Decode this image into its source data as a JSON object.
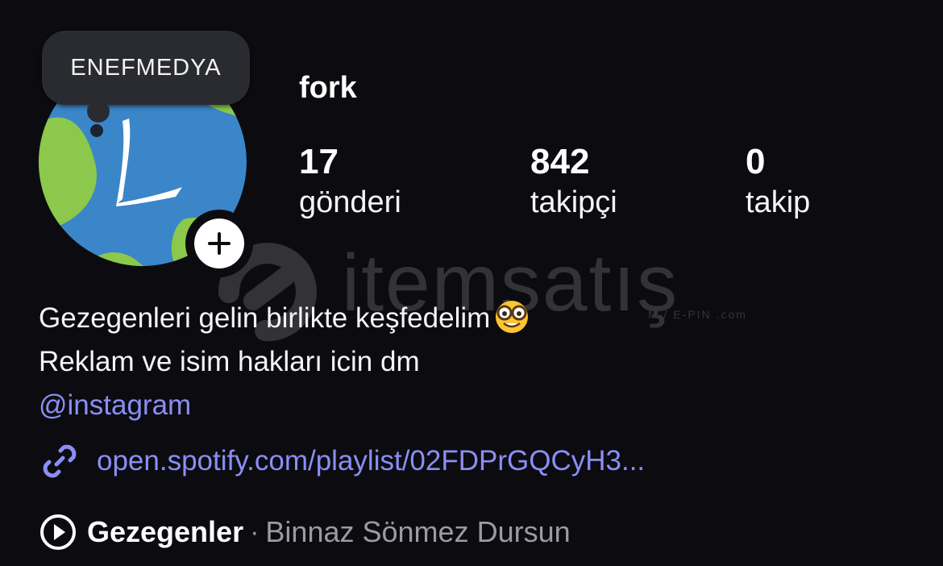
{
  "profile": {
    "note": "ENEFMEDYA",
    "username": "fork",
    "avatar_icon": "earth-l-logo-icon",
    "add_story_icon": "plus-icon"
  },
  "stats": [
    {
      "value": "17",
      "label": "gönderi"
    },
    {
      "value": "842",
      "label": "takipçi"
    },
    {
      "value": "0",
      "label": "takip"
    }
  ],
  "bio": {
    "line1": "Gezegenleri gelin birlikte keşfedelim",
    "line1_emoji": "nerd-face-emoji",
    "line2": "Reklam ve isim hakları icin dm",
    "mention": "@instagram"
  },
  "link": {
    "icon": "link-icon",
    "text": "open.spotify.com/playlist/02FDPrGQCyH3..."
  },
  "music": {
    "icon": "play-circle-icon",
    "title": "Gezegenler",
    "separator": "·",
    "artist": "Binnaz Sönmez Dursun"
  },
  "watermark": {
    "text": "itemsatış",
    "subtext": "M / E-PIN .com"
  },
  "colors": {
    "background": "#0c0c10",
    "link": "#8b8ef5",
    "secondary_text": "#9a9ba3",
    "bubble": "#2a2b30"
  }
}
